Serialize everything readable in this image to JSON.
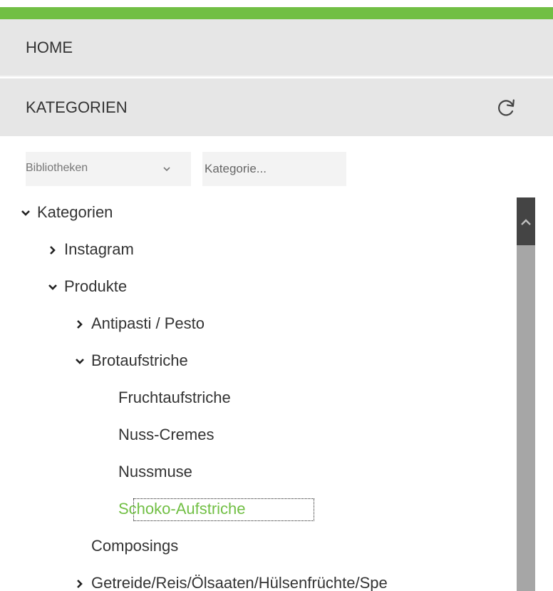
{
  "accent_color": "#71bf44",
  "nav": {
    "home_label": "HOME",
    "categories_label": "KATEGORIEN"
  },
  "filters": {
    "library_select_value": "Bibliotheken",
    "search_placeholder": "Kategorie..."
  },
  "tree": [
    {
      "label": "Kategorien",
      "level": 0,
      "state": "expanded"
    },
    {
      "label": "Instagram",
      "level": 1,
      "state": "collapsed"
    },
    {
      "label": "Produkte",
      "level": 1,
      "state": "expanded"
    },
    {
      "label": "Antipasti / Pesto",
      "level": 2,
      "state": "collapsed"
    },
    {
      "label": "Brotaufstriche",
      "level": 2,
      "state": "expanded"
    },
    {
      "label": "Fruchtaufstriche",
      "level": 3,
      "state": "leaf"
    },
    {
      "label": "Nuss-Cremes",
      "level": 3,
      "state": "leaf"
    },
    {
      "label": "Nussmuse",
      "level": 3,
      "state": "leaf"
    },
    {
      "label": "Schoko-Aufstriche",
      "level": 3,
      "state": "leaf",
      "selected": true
    },
    {
      "label": "Composings",
      "level": 2,
      "state": "leaf"
    },
    {
      "label": "Getreide/Reis/Ölsaaten/Hülsenfrüchte/Spe",
      "level": 2,
      "state": "collapsed"
    }
  ],
  "icons": {
    "refresh": "refresh-icon",
    "select_chevron": "chevron-down-icon",
    "expanded": "chevron-down-icon",
    "collapsed": "chevron-right-icon",
    "scroll_up": "chevron-up-icon"
  }
}
